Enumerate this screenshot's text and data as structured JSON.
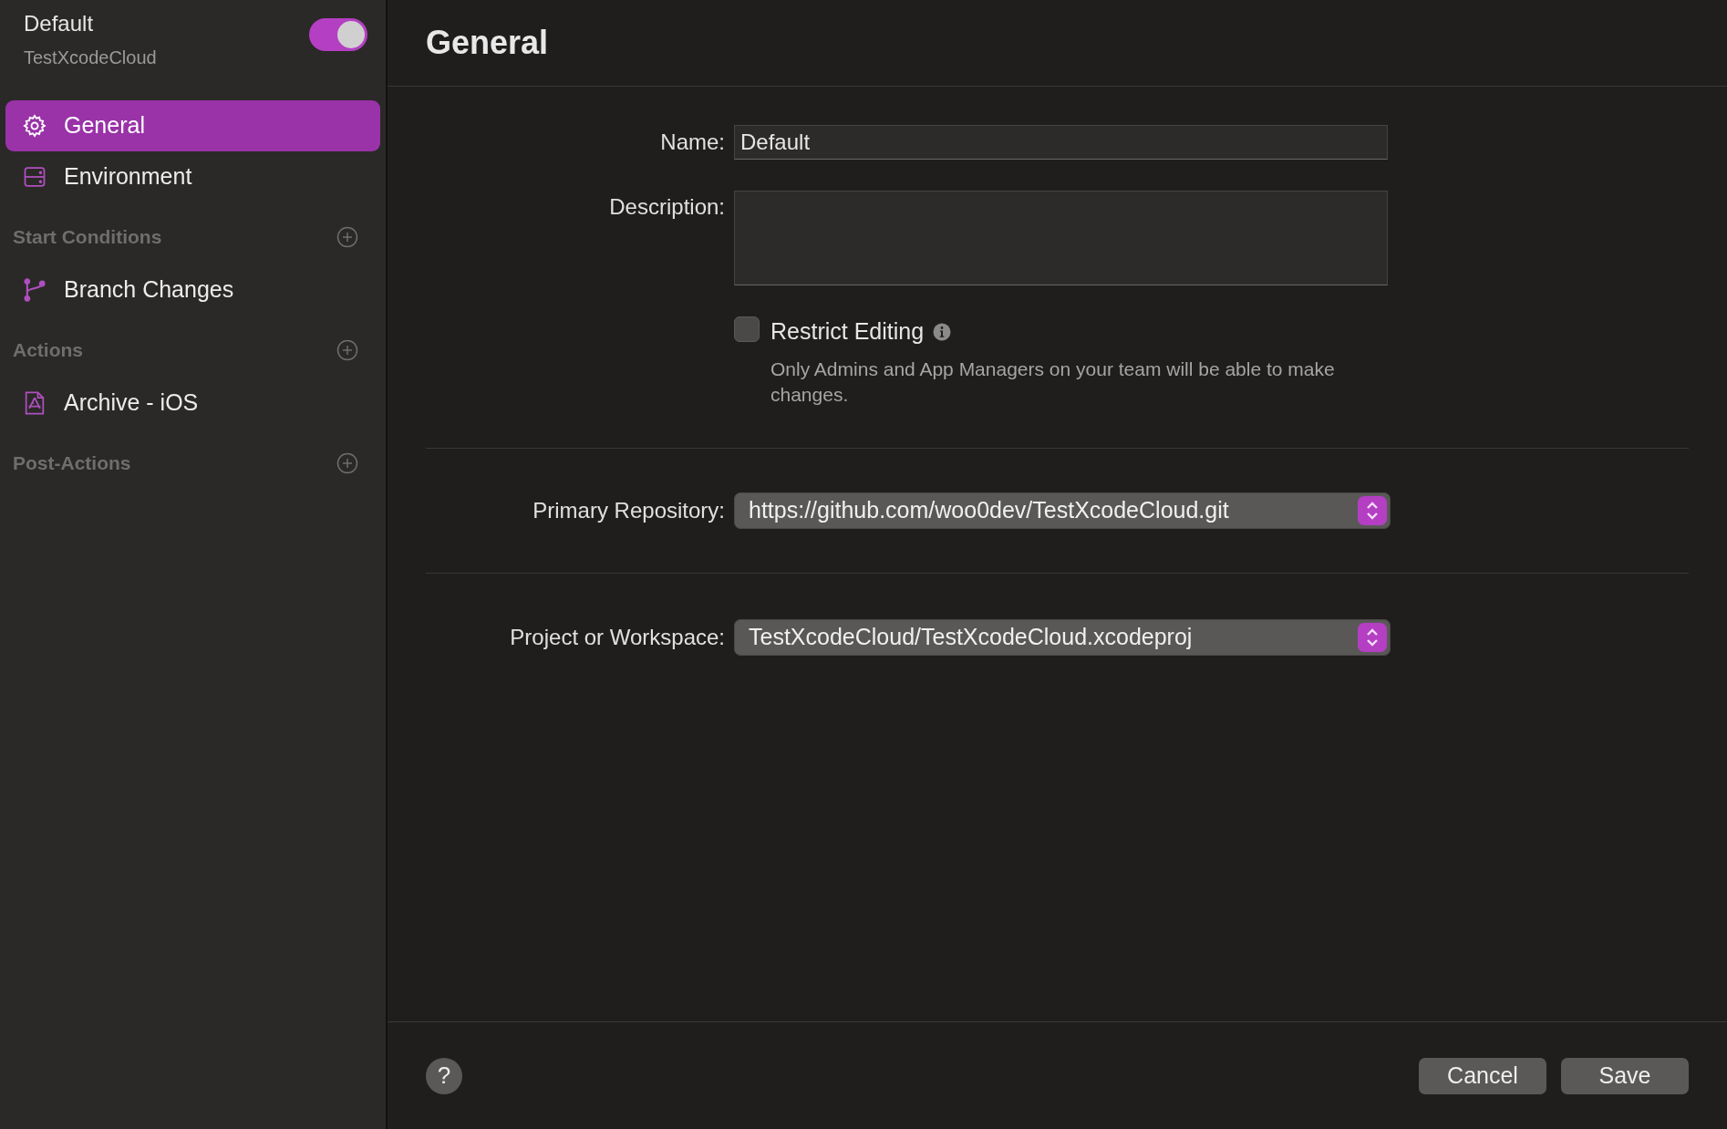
{
  "sidebar": {
    "workflow": {
      "title": "Default",
      "subtitle": "TestXcodeCloud",
      "enabled": true
    },
    "items": [
      {
        "kind": "item",
        "label": "General",
        "selected": true
      },
      {
        "kind": "item",
        "label": "Environment",
        "selected": false
      },
      {
        "kind": "section",
        "label": "Start Conditions"
      },
      {
        "kind": "item",
        "label": "Branch Changes",
        "selected": false
      },
      {
        "kind": "section",
        "label": "Actions"
      },
      {
        "kind": "item",
        "label": "Archive - iOS",
        "selected": false
      },
      {
        "kind": "section",
        "label": "Post-Actions"
      }
    ]
  },
  "header": {
    "title": "General"
  },
  "form": {
    "name": {
      "label": "Name:",
      "value": "Default"
    },
    "description": {
      "label": "Description:"
    },
    "restrict": {
      "label": "Restrict Editing",
      "checked": false,
      "note": "Only Admins and App Managers on your team will be able to make changes."
    },
    "repository": {
      "label": "Primary Repository:",
      "value": "https://github.com/woo0dev/TestXcodeCloud.git"
    },
    "project": {
      "label": "Project or Workspace:",
      "value": "TestXcodeCloud/TestXcodeCloud.xcodeproj"
    }
  },
  "footer": {
    "help": "?",
    "buttons": [
      "Cancel",
      "Save"
    ]
  }
}
